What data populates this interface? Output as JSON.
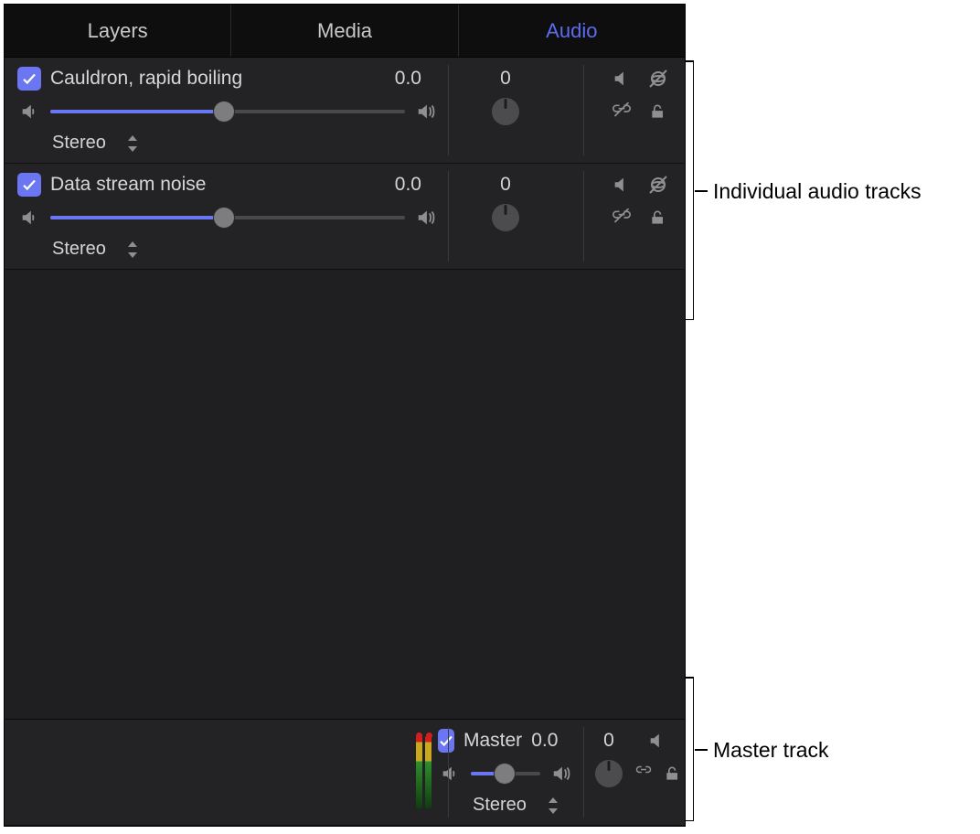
{
  "tabs": {
    "layers": "Layers",
    "media": "Media",
    "audio": "Audio",
    "active": "audio"
  },
  "tracks": [
    {
      "name": "Cauldron, rapid boiling",
      "volume": "0.0",
      "pan": "0",
      "channel": "Stereo",
      "slider_pct": 49
    },
    {
      "name": "Data stream noise",
      "volume": "0.0",
      "pan": "0",
      "channel": "Stereo",
      "slider_pct": 49
    }
  ],
  "master": {
    "name": "Master",
    "volume": "0.0",
    "pan": "0",
    "channel": "Stereo",
    "slider_pct": 49
  },
  "annotations": {
    "individual": "Individual audio tracks",
    "master": "Master track"
  }
}
